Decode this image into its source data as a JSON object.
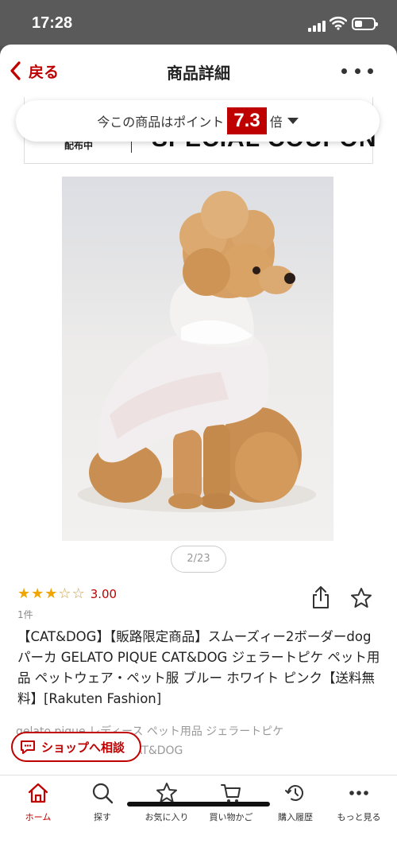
{
  "status_bar": {
    "time": "17:28"
  },
  "nav": {
    "back_label": "戻る",
    "title": "商品詳細"
  },
  "coupon": {
    "distribution_label": "配布中",
    "headline": "SPECIAL COUPON"
  },
  "points": {
    "prefix": "今この商品はポイント",
    "multiplier": "7.3",
    "suffix": "倍"
  },
  "gallery": {
    "pager": "2/23"
  },
  "rating": {
    "stars_filled": 3,
    "stars_total": 5,
    "score": "3.00",
    "review_count": "1件"
  },
  "product": {
    "title": "【CAT&DOG】【販路限定商品】スムーズィー2ボーダーdogパーカ GELATO PIQUE CAT&DOG ジェラートピケ ペット用品 ペットウェア・ペット服 ブルー ホワイト ピンク【送料無料】[Rakuten Fashion]",
    "subcategory_line1": "gelato pique レディース ペット用品 ジェラートピケ",
    "subcategory_line2": "CAT&DOG"
  },
  "shop_button": {
    "label": "ショップへ相談"
  },
  "tabs": [
    {
      "label": "ホーム",
      "icon": "home-icon",
      "active": true
    },
    {
      "label": "探す",
      "icon": "search-icon",
      "active": false
    },
    {
      "label": "お気に入り",
      "icon": "star-icon",
      "active": false
    },
    {
      "label": "買い物かご",
      "icon": "cart-icon",
      "active": false
    },
    {
      "label": "購入履歴",
      "icon": "history-icon",
      "active": false
    },
    {
      "label": "もっと見る",
      "icon": "more-icon",
      "active": false
    }
  ],
  "colors": {
    "accent": "#bf0000",
    "star": "#f0a500"
  }
}
